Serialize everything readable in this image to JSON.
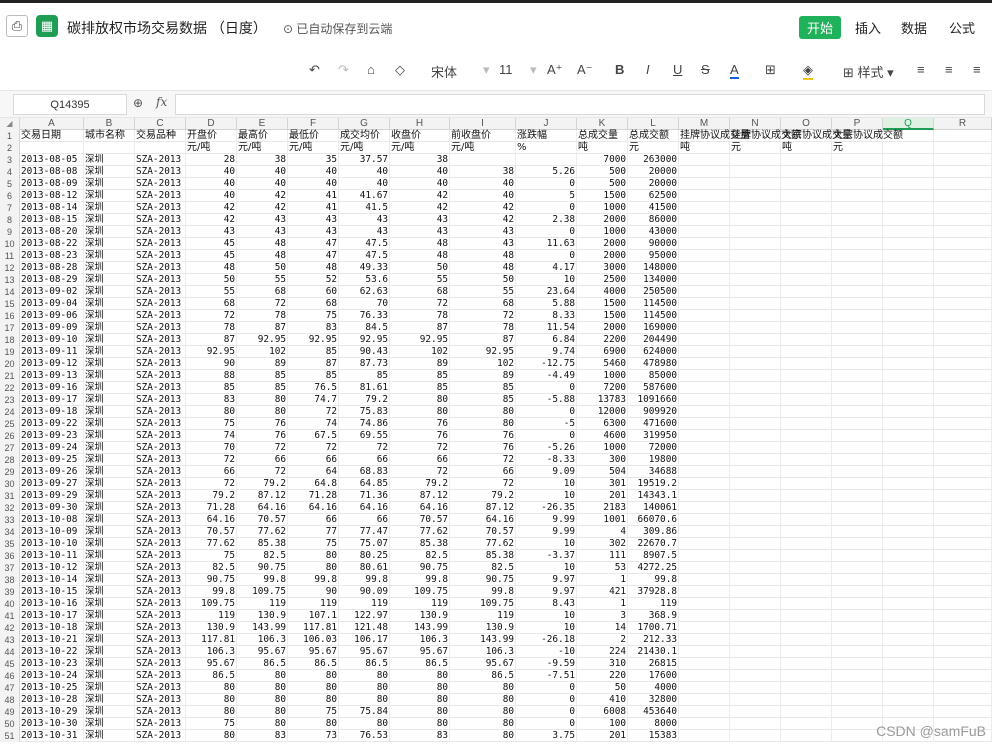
{
  "header": {
    "save_icon": "save-icon",
    "app_icon": "spreadsheet-app-icon",
    "title": "碳排放权市场交易数据 （日度）",
    "autosave": "已自动保存到云端",
    "menus": [
      "开始",
      "插入",
      "数据",
      "公式"
    ]
  },
  "toolbar": {
    "undo": "↶",
    "redo": "↷",
    "format_painter": "⌂",
    "clear": "◇",
    "font": "宋体",
    "font_size": "11",
    "grow": "A⁺",
    "shrink": "A⁻",
    "bold": "B",
    "italic": "I",
    "underline": "U",
    "strike": "S",
    "font_color": "A",
    "borders": "⊞",
    "fill": "◈",
    "styles": "样式",
    "align_left": "≡",
    "align_center": "≡",
    "align_right": "≡"
  },
  "formula_bar": {
    "cell_ref": "Q14395",
    "zoom_icon": "zoom-icon",
    "fx": "fx",
    "value": ""
  },
  "columns": [
    "A",
    "B",
    "C",
    "D",
    "E",
    "F",
    "G",
    "H",
    "I",
    "J",
    "K",
    "L",
    "M",
    "N",
    "O",
    "P",
    "Q",
    "R"
  ],
  "header_row1": [
    "交易日期",
    "城市名称",
    "交易品种",
    "开盘价",
    "最高价",
    "最低价",
    "成交均价",
    "收盘价",
    "前收盘价",
    "涨跌幅",
    "总成交量",
    "总成交额",
    "挂牌协议成交量",
    "挂牌协议成交额",
    "大宗协议成交量",
    "大宗协议成交额",
    "",
    ""
  ],
  "header_row2": [
    "",
    "",
    "",
    "元/吨",
    "元/吨",
    "元/吨",
    "元/吨",
    "元/吨",
    "元/吨",
    "%",
    "吨",
    "元",
    "吨",
    "元",
    "吨",
    "元",
    "",
    ""
  ],
  "rows": [
    [
      "2013-08-05",
      "深圳",
      "SZA-2013",
      "28",
      "38",
      "35",
      "37.57",
      "38",
      "",
      "",
      "7000",
      "263000"
    ],
    [
      "2013-08-08",
      "深圳",
      "SZA-2013",
      "40",
      "40",
      "40",
      "40",
      "40",
      "38",
      "5.26",
      "500",
      "20000"
    ],
    [
      "2013-08-09",
      "深圳",
      "SZA-2013",
      "40",
      "40",
      "40",
      "40",
      "40",
      "40",
      "0",
      "500",
      "20000"
    ],
    [
      "2013-08-12",
      "深圳",
      "SZA-2013",
      "40",
      "42",
      "41",
      "41.67",
      "42",
      "40",
      "5",
      "1500",
      "62500"
    ],
    [
      "2013-08-14",
      "深圳",
      "SZA-2013",
      "42",
      "42",
      "41",
      "41.5",
      "42",
      "42",
      "0",
      "1000",
      "41500"
    ],
    [
      "2013-08-15",
      "深圳",
      "SZA-2013",
      "42",
      "43",
      "43",
      "43",
      "43",
      "42",
      "2.38",
      "2000",
      "86000"
    ],
    [
      "2013-08-20",
      "深圳",
      "SZA-2013",
      "43",
      "43",
      "43",
      "43",
      "43",
      "43",
      "0",
      "1000",
      "43000"
    ],
    [
      "2013-08-22",
      "深圳",
      "SZA-2013",
      "45",
      "48",
      "47",
      "47.5",
      "48",
      "43",
      "11.63",
      "2000",
      "90000"
    ],
    [
      "2013-08-23",
      "深圳",
      "SZA-2013",
      "45",
      "48",
      "47",
      "47.5",
      "48",
      "48",
      "0",
      "2000",
      "95000"
    ],
    [
      "2013-08-28",
      "深圳",
      "SZA-2013",
      "48",
      "50",
      "48",
      "49.33",
      "50",
      "48",
      "4.17",
      "3000",
      "148000"
    ],
    [
      "2013-08-29",
      "深圳",
      "SZA-2013",
      "50",
      "55",
      "52",
      "53.6",
      "55",
      "50",
      "10",
      "2500",
      "134000"
    ],
    [
      "2013-09-02",
      "深圳",
      "SZA-2013",
      "55",
      "68",
      "60",
      "62.63",
      "68",
      "55",
      "23.64",
      "4000",
      "250500"
    ],
    [
      "2013-09-04",
      "深圳",
      "SZA-2013",
      "68",
      "72",
      "68",
      "70",
      "72",
      "68",
      "5.88",
      "1500",
      "114500"
    ],
    [
      "2013-09-06",
      "深圳",
      "SZA-2013",
      "72",
      "78",
      "75",
      "76.33",
      "78",
      "72",
      "8.33",
      "1500",
      "114500"
    ],
    [
      "2013-09-09",
      "深圳",
      "SZA-2013",
      "78",
      "87",
      "83",
      "84.5",
      "87",
      "78",
      "11.54",
      "2000",
      "169000"
    ],
    [
      "2013-09-10",
      "深圳",
      "SZA-2013",
      "87",
      "92.95",
      "92.95",
      "92.95",
      "92.95",
      "87",
      "6.84",
      "2200",
      "204490"
    ],
    [
      "2013-09-11",
      "深圳",
      "SZA-2013",
      "92.95",
      "102",
      "85",
      "90.43",
      "102",
      "92.95",
      "9.74",
      "6900",
      "624000"
    ],
    [
      "2013-09-12",
      "深圳",
      "SZA-2013",
      "90",
      "89",
      "87",
      "87.73",
      "89",
      "102",
      "-12.75",
      "5460",
      "478980"
    ],
    [
      "2013-09-13",
      "深圳",
      "SZA-2013",
      "88",
      "85",
      "85",
      "85",
      "85",
      "89",
      "-4.49",
      "1000",
      "85000"
    ],
    [
      "2013-09-16",
      "深圳",
      "SZA-2013",
      "85",
      "85",
      "76.5",
      "81.61",
      "85",
      "85",
      "0",
      "7200",
      "587600"
    ],
    [
      "2013-09-17",
      "深圳",
      "SZA-2013",
      "83",
      "80",
      "74.7",
      "79.2",
      "80",
      "85",
      "-5.88",
      "13783",
      "1091660"
    ],
    [
      "2013-09-18",
      "深圳",
      "SZA-2013",
      "80",
      "80",
      "72",
      "75.83",
      "80",
      "80",
      "0",
      "12000",
      "909920"
    ],
    [
      "2013-09-22",
      "深圳",
      "SZA-2013",
      "75",
      "76",
      "74",
      "74.86",
      "76",
      "80",
      "-5",
      "6300",
      "471600"
    ],
    [
      "2013-09-23",
      "深圳",
      "SZA-2013",
      "74",
      "76",
      "67.5",
      "69.55",
      "76",
      "76",
      "0",
      "4600",
      "319950"
    ],
    [
      "2013-09-24",
      "深圳",
      "SZA-2013",
      "70",
      "72",
      "72",
      "72",
      "72",
      "76",
      "-5.26",
      "1000",
      "72000"
    ],
    [
      "2013-09-25",
      "深圳",
      "SZA-2013",
      "72",
      "66",
      "66",
      "66",
      "66",
      "72",
      "-8.33",
      "300",
      "19800"
    ],
    [
      "2013-09-26",
      "深圳",
      "SZA-2013",
      "66",
      "72",
      "64",
      "68.83",
      "72",
      "66",
      "9.09",
      "504",
      "34688"
    ],
    [
      "2013-09-27",
      "深圳",
      "SZA-2013",
      "72",
      "79.2",
      "64.8",
      "64.85",
      "79.2",
      "72",
      "10",
      "301",
      "19519.2"
    ],
    [
      "2013-09-29",
      "深圳",
      "SZA-2013",
      "79.2",
      "87.12",
      "71.28",
      "71.36",
      "87.12",
      "79.2",
      "10",
      "201",
      "14343.1"
    ],
    [
      "2013-09-30",
      "深圳",
      "SZA-2013",
      "71.28",
      "64.16",
      "64.16",
      "64.16",
      "64.16",
      "87.12",
      "-26.35",
      "2183",
      "140061"
    ],
    [
      "2013-10-08",
      "深圳",
      "SZA-2013",
      "64.16",
      "70.57",
      "66",
      "66",
      "70.57",
      "64.16",
      "9.99",
      "1001",
      "66070.6"
    ],
    [
      "2013-10-09",
      "深圳",
      "SZA-2013",
      "70.57",
      "77.62",
      "77",
      "77.47",
      "77.62",
      "70.57",
      "9.99",
      "4",
      "309.86"
    ],
    [
      "2013-10-10",
      "深圳",
      "SZA-2013",
      "77.62",
      "85.38",
      "75",
      "75.07",
      "85.38",
      "77.62",
      "10",
      "302",
      "22670.7"
    ],
    [
      "2013-10-11",
      "深圳",
      "SZA-2013",
      "75",
      "82.5",
      "80",
      "80.25",
      "82.5",
      "85.38",
      "-3.37",
      "111",
      "8907.5"
    ],
    [
      "2013-10-12",
      "深圳",
      "SZA-2013",
      "82.5",
      "90.75",
      "80",
      "80.61",
      "90.75",
      "82.5",
      "10",
      "53",
      "4272.25"
    ],
    [
      "2013-10-14",
      "深圳",
      "SZA-2013",
      "90.75",
      "99.8",
      "99.8",
      "99.8",
      "99.8",
      "90.75",
      "9.97",
      "1",
      "99.8"
    ],
    [
      "2013-10-15",
      "深圳",
      "SZA-2013",
      "99.8",
      "109.75",
      "90",
      "90.09",
      "109.75",
      "99.8",
      "9.97",
      "421",
      "37928.8"
    ],
    [
      "2013-10-16",
      "深圳",
      "SZA-2013",
      "109.75",
      "119",
      "119",
      "119",
      "119",
      "109.75",
      "8.43",
      "1",
      "119"
    ],
    [
      "2013-10-17",
      "深圳",
      "SZA-2013",
      "119",
      "130.9",
      "107.1",
      "122.97",
      "130.9",
      "119",
      "10",
      "3",
      "368.9"
    ],
    [
      "2013-10-18",
      "深圳",
      "SZA-2013",
      "130.9",
      "143.99",
      "117.81",
      "121.48",
      "143.99",
      "130.9",
      "10",
      "14",
      "1700.71"
    ],
    [
      "2013-10-21",
      "深圳",
      "SZA-2013",
      "117.81",
      "106.3",
      "106.03",
      "106.17",
      "106.3",
      "143.99",
      "-26.18",
      "2",
      "212.33"
    ],
    [
      "2013-10-22",
      "深圳",
      "SZA-2013",
      "106.3",
      "95.67",
      "95.67",
      "95.67",
      "95.67",
      "106.3",
      "-10",
      "224",
      "21430.1"
    ],
    [
      "2013-10-23",
      "深圳",
      "SZA-2013",
      "95.67",
      "86.5",
      "86.5",
      "86.5",
      "86.5",
      "95.67",
      "-9.59",
      "310",
      "26815"
    ],
    [
      "2013-10-24",
      "深圳",
      "SZA-2013",
      "86.5",
      "80",
      "80",
      "80",
      "80",
      "86.5",
      "-7.51",
      "220",
      "17600"
    ],
    [
      "2013-10-25",
      "深圳",
      "SZA-2013",
      "80",
      "80",
      "80",
      "80",
      "80",
      "80",
      "0",
      "50",
      "4000"
    ],
    [
      "2013-10-28",
      "深圳",
      "SZA-2013",
      "80",
      "80",
      "80",
      "80",
      "80",
      "80",
      "0",
      "410",
      "32800"
    ],
    [
      "2013-10-29",
      "深圳",
      "SZA-2013",
      "80",
      "80",
      "75",
      "75.84",
      "80",
      "80",
      "0",
      "6008",
      "453640"
    ],
    [
      "2013-10-30",
      "深圳",
      "SZA-2013",
      "75",
      "80",
      "80",
      "80",
      "80",
      "80",
      "0",
      "100",
      "8000"
    ],
    [
      "2013-10-31",
      "深圳",
      "SZA-2013",
      "80",
      "83",
      "73",
      "76.53",
      "83",
      "80",
      "3.75",
      "201",
      "15383"
    ]
  ],
  "watermark": "CSDN @samFuB",
  "colors": {
    "accent": "#1f9d55",
    "grid": "#e8e8e8"
  }
}
